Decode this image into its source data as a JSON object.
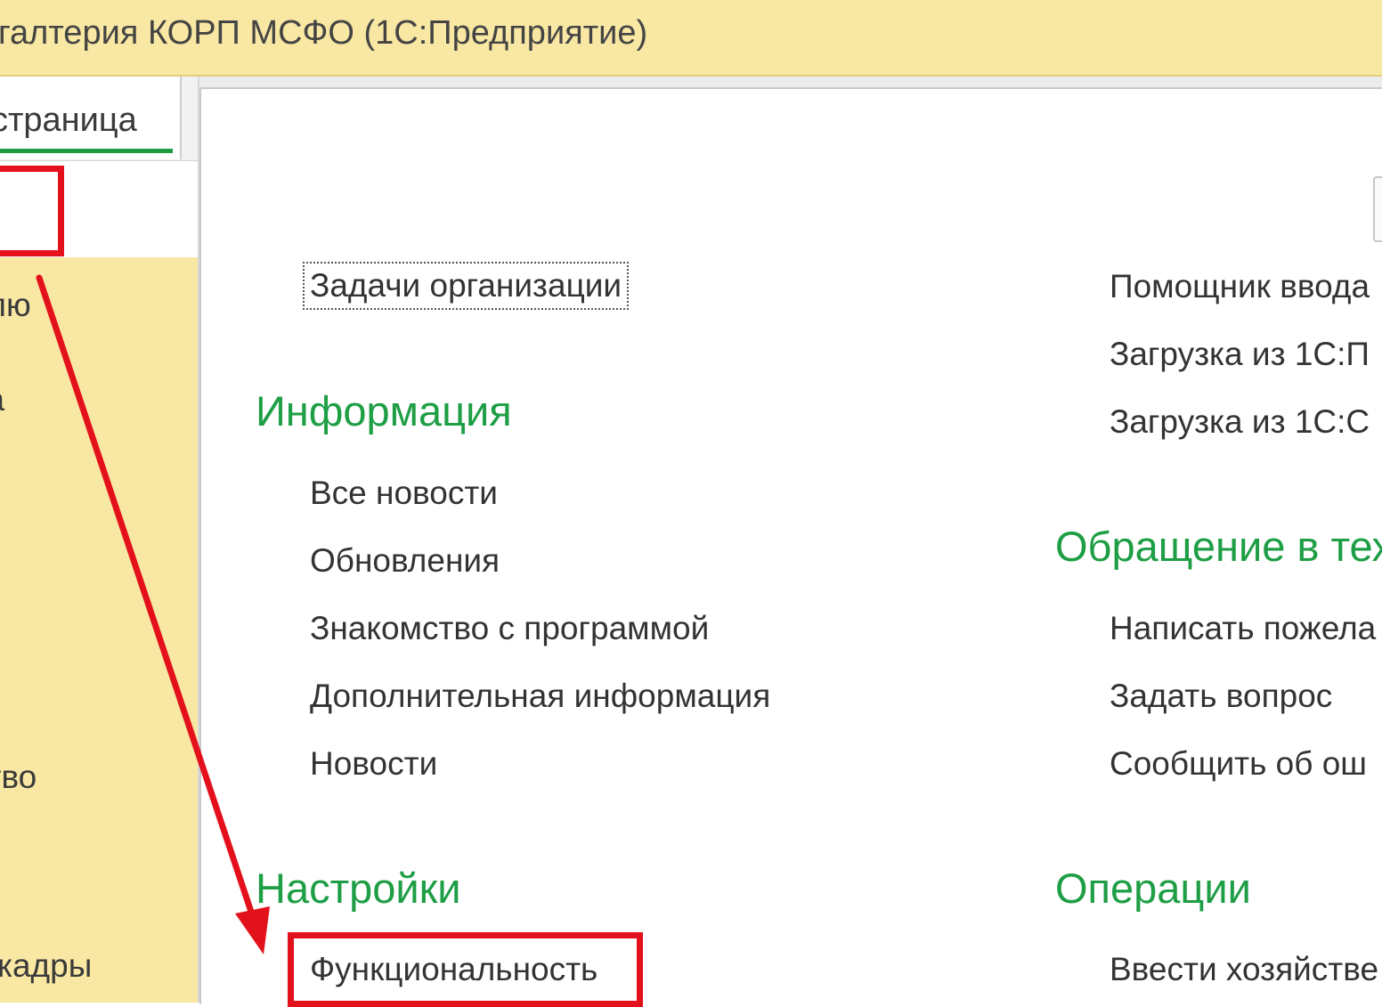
{
  "window": {
    "title": "галтерия КОРП МСФО  (1С:Предприятие)"
  },
  "sidebar": {
    "tab_label": "страница",
    "items": [
      {
        "label": "елю"
      },
      {
        "label": "са"
      },
      {
        "label": "ство"
      },
      {
        "label": "и кадры"
      }
    ]
  },
  "main": {
    "left_column": {
      "top_link": "Задачи организации",
      "sections": [
        {
          "heading": "Информация",
          "links": [
            "Все новости",
            "Обновления",
            "Знакомство с программой",
            "Дополнительная информация",
            "Новости"
          ]
        },
        {
          "heading": "Настройки",
          "links": [
            "Функциональность"
          ]
        }
      ]
    },
    "right_column": {
      "top_links": [
        "Помощник ввода",
        "Загрузка из 1С:П",
        "Загрузка из 1С:С"
      ],
      "sections": [
        {
          "heading": "Обращение в тех",
          "links": [
            "Написать пожела",
            "Задать вопрос",
            "Сообщить об ош"
          ]
        },
        {
          "heading": "Операции",
          "links": [
            "Ввести хозяйстве"
          ]
        }
      ]
    }
  },
  "colors": {
    "accent_green": "#1e9e45",
    "sidebar_yellow": "#f9e8a3",
    "annotation_red": "#e3111c"
  }
}
